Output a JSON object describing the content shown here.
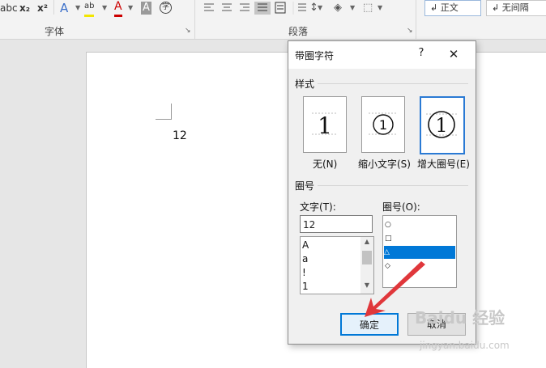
{
  "ribbon": {
    "font_group_label": "字体",
    "paragraph_group_label": "段落",
    "font_tools": [
      "abc",
      "x₂",
      "x²",
      "A",
      "ab",
      "A",
      "A",
      "字"
    ],
    "styles": [
      "↲ 正文",
      "↲ 无间隔"
    ]
  },
  "document": {
    "text": "12"
  },
  "dialog": {
    "title": "带圈字符",
    "help": "?",
    "close": "✕",
    "style_section": "样式",
    "style_options": [
      {
        "label": "无(N)",
        "glyph": "1",
        "shape": "none"
      },
      {
        "label": "缩小文字(S)",
        "glyph": "①",
        "shape": "shrink"
      },
      {
        "label": "增大圈号(E)",
        "glyph": "①",
        "shape": "enlarge",
        "selected": true
      }
    ],
    "enclosure_section": "圈号",
    "text_label": "文字(T):",
    "text_value": "12",
    "text_list": [
      "A",
      "a",
      "!",
      "1"
    ],
    "enclosure_label": "圈号(O):",
    "enclosure_list": [
      "○",
      "□",
      "△",
      "◇"
    ],
    "enclosure_selected_index": 2,
    "ok_label": "确定",
    "cancel_label": "取消"
  },
  "watermark": {
    "main": "Baidu 经验",
    "sub": "jingyan.baidu.com"
  },
  "colors": {
    "accent": "#0078d7",
    "arrow": "#e0373b"
  }
}
